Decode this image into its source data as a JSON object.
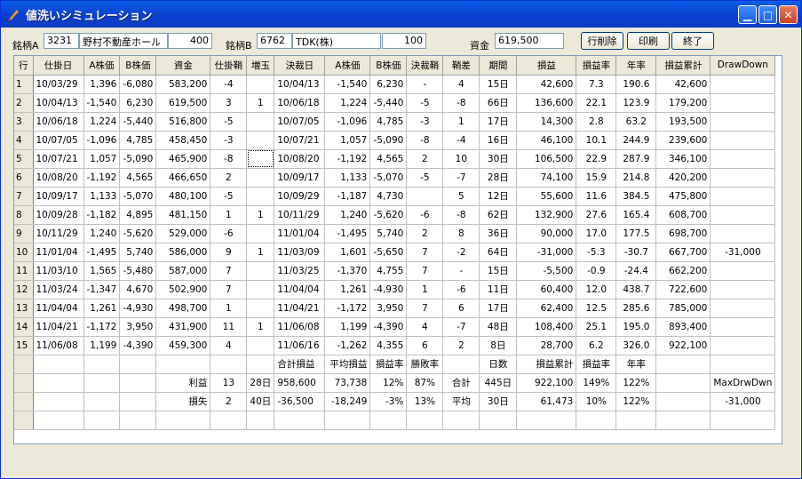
{
  "window": {
    "title": "値洗いシミュレーション"
  },
  "controls": {
    "stockA_label": "銘柄A",
    "stockA_code": "3231",
    "stockA_name": "野村不動産ホール",
    "stockA_qty": "400",
    "stockB_label": "銘柄B",
    "stockB_code": "6762",
    "stockB_name": "TDK(株)",
    "stockB_qty": "100",
    "capital_label": "資金",
    "capital_value": "619,500",
    "delete_row": "行削除",
    "print": "印刷",
    "exit": "終了"
  },
  "table": {
    "headers": [
      "行",
      "仕掛日",
      "A株価",
      "B株価",
      "資金",
      "仕掛鞘",
      "増玉",
      "決裁日",
      "A株価",
      "B株価",
      "決裁鞘",
      "鞘差",
      "期間",
      "損益",
      "損益率",
      "年率",
      "損益累計",
      "DrawDown"
    ],
    "rows": [
      [
        "1",
        "10/03/29",
        "1,396",
        "-6,080",
        "583,200",
        "-4",
        "",
        "10/04/13",
        "-1,540",
        "6,230",
        "-",
        "4",
        "15日",
        "42,600",
        "7.3",
        "190.6",
        "42,600",
        ""
      ],
      [
        "2",
        "10/04/13",
        "-1,540",
        "6,230",
        "619,500",
        "3",
        "1",
        "10/06/18",
        "1,224",
        "-5,440",
        "-5",
        "-8",
        "66日",
        "136,600",
        "22.1",
        "123.9",
        "179,200",
        ""
      ],
      [
        "3",
        "10/06/18",
        "1,224",
        "-5,440",
        "516,800",
        "-5",
        "",
        "10/07/05",
        "-1,096",
        "4,785",
        "-3",
        "1",
        "17日",
        "14,300",
        "2.8",
        "63.2",
        "193,500",
        ""
      ],
      [
        "4",
        "10/07/05",
        "-1,096",
        "4,785",
        "458,450",
        "-3",
        "",
        "10/07/21",
        "1,057",
        "-5,090",
        "-8",
        "-4",
        "16日",
        "46,100",
        "10.1",
        "244.9",
        "239,600",
        ""
      ],
      [
        "5",
        "10/07/21",
        "1,057",
        "-5,090",
        "465,900",
        "-8",
        "",
        "10/08/20",
        "-1,192",
        "4,565",
        "2",
        "10",
        "30日",
        "106,500",
        "22.9",
        "287.9",
        "346,100",
        ""
      ],
      [
        "6",
        "10/08/20",
        "-1,192",
        "4,565",
        "466,650",
        "2",
        "",
        "10/09/17",
        "1,133",
        "-5,070",
        "-5",
        "-7",
        "28日",
        "74,100",
        "15.9",
        "214.8",
        "420,200",
        ""
      ],
      [
        "7",
        "10/09/17",
        "1,133",
        "-5,070",
        "480,100",
        "-5",
        "",
        "10/09/29",
        "-1,187",
        "4,730",
        "",
        "5",
        "12日",
        "55,600",
        "11.6",
        "384.5",
        "475,800",
        ""
      ],
      [
        "8",
        "10/09/28",
        "-1,182",
        "4,895",
        "481,150",
        "1",
        "1",
        "10/11/29",
        "1,240",
        "-5,620",
        "-6",
        "-8",
        "62日",
        "132,900",
        "27.6",
        "165.4",
        "608,700",
        ""
      ],
      [
        "9",
        "10/11/29",
        "1,240",
        "-5,620",
        "529,000",
        "-6",
        "",
        "11/01/04",
        "-1,495",
        "5,740",
        "2",
        "8",
        "36日",
        "90,000",
        "17.0",
        "177.5",
        "698,700",
        ""
      ],
      [
        "10",
        "11/01/04",
        "-1,495",
        "5,740",
        "586,000",
        "9",
        "1",
        "11/03/09",
        "1,601",
        "-5,650",
        "7",
        "-2",
        "64日",
        "-31,000",
        "-5.3",
        "-30.7",
        "667,700",
        "-31,000"
      ],
      [
        "11",
        "11/03/10",
        "1,565",
        "-5,480",
        "587,000",
        "7",
        "",
        "11/03/25",
        "-1,370",
        "4,755",
        "7",
        "-",
        "15日",
        "-5,500",
        "-0.9",
        "-24.4",
        "662,200",
        ""
      ],
      [
        "12",
        "11/03/24",
        "-1,347",
        "4,670",
        "502,900",
        "7",
        "",
        "11/04/04",
        "1,261",
        "-4,930",
        "1",
        "-6",
        "11日",
        "60,400",
        "12.0",
        "438.7",
        "722,600",
        ""
      ],
      [
        "13",
        "11/04/04",
        "1,261",
        "-4,930",
        "498,700",
        "1",
        "",
        "11/04/21",
        "-1,172",
        "3,950",
        "7",
        "6",
        "17日",
        "62,400",
        "12.5",
        "285.6",
        "785,000",
        ""
      ],
      [
        "14",
        "11/04/21",
        "-1,172",
        "3,950",
        "431,900",
        "11",
        "1",
        "11/06/08",
        "1,199",
        "-4,390",
        "4",
        "-7",
        "48日",
        "108,400",
        "25.1",
        "195.0",
        "893,400",
        ""
      ],
      [
        "15",
        "11/06/08",
        "1,199",
        "-4,390",
        "459,300",
        "4",
        "",
        "11/06/16",
        "-1,262",
        "4,355",
        "6",
        "2",
        "8日",
        "28,700",
        "6.2",
        "326.0",
        "922,100",
        ""
      ]
    ],
    "summary_header": [
      "",
      "",
      "",
      "",
      "",
      "",
      "",
      "合計損益",
      "平均損益",
      "損益率",
      "勝敗率",
      "",
      "日数",
      "損益累計",
      "損益率",
      "年率",
      "",
      ""
    ],
    "summary_profit": [
      "",
      "",
      "",
      "",
      "利益",
      "13",
      "28日",
      "958,600",
      "73,738",
      "12%",
      "87%",
      "合計",
      "445日",
      "922,100",
      "149%",
      "122%",
      "",
      "MaxDrwDwn"
    ],
    "summary_loss": [
      "",
      "",
      "",
      "",
      "損失",
      "2",
      "40日",
      "-36,500",
      "-18,249",
      "-3%",
      "13%",
      "平均",
      "30日",
      "61,473",
      "10%",
      "122%",
      "",
      "-31,000"
    ],
    "empty_rows": 1
  }
}
